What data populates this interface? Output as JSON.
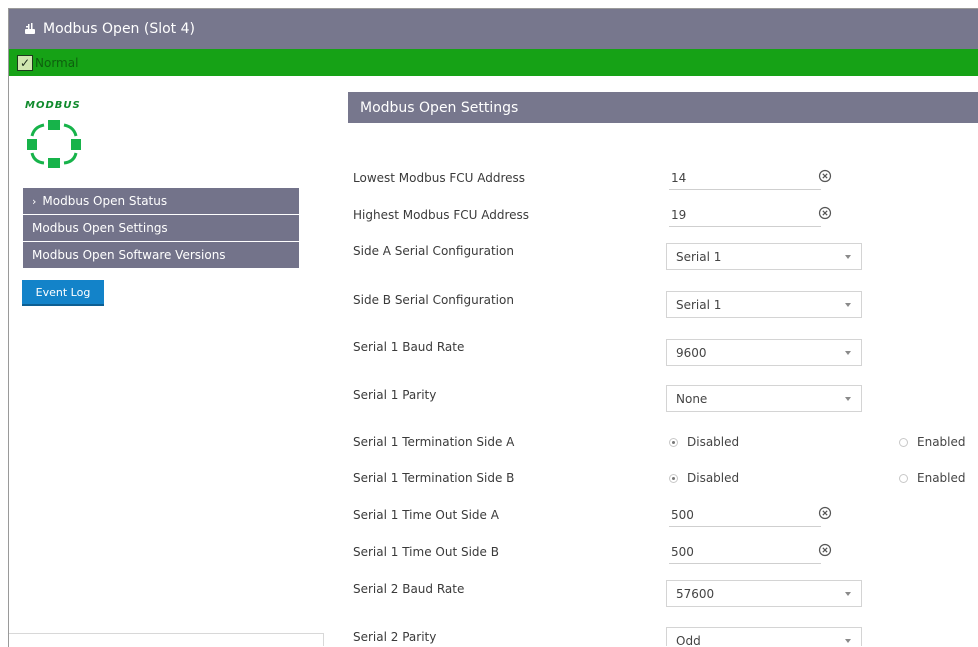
{
  "window": {
    "title": "Modbus Open (Slot 4)",
    "title_icon": "plug-icon"
  },
  "status": {
    "text": "Normal",
    "checked": true,
    "color": "#16a216"
  },
  "sidebar": {
    "logo_text": "MODBUS",
    "items": [
      {
        "label": "Modbus Open Status",
        "chevron": "›"
      },
      {
        "label": "Modbus Open Settings"
      },
      {
        "label": "Modbus Open Software Versions"
      }
    ],
    "event_log_label": "Event Log"
  },
  "main": {
    "section_title": "Modbus Open Settings",
    "fields": {
      "lowest_fcu": {
        "label": "Lowest Modbus FCU Address",
        "value": "14"
      },
      "highest_fcu": {
        "label": "Highest Modbus FCU Address",
        "value": "19"
      },
      "side_a_serial": {
        "label": "Side A Serial Configuration",
        "value": "Serial 1"
      },
      "side_b_serial": {
        "label": "Side B Serial Configuration",
        "value": "Serial 1"
      },
      "serial1_baud": {
        "label": "Serial 1 Baud Rate",
        "value": "9600"
      },
      "serial1_parity": {
        "label": "Serial 1 Parity",
        "value": "None"
      },
      "serial1_term_a": {
        "label": "Serial 1 Termination Side A",
        "option_disabled": "Disabled",
        "option_enabled": "Enabled",
        "selected": "Disabled"
      },
      "serial1_term_b": {
        "label": "Serial 1 Termination Side B",
        "option_disabled": "Disabled",
        "option_enabled": "Enabled",
        "selected": "Disabled"
      },
      "serial1_timeout_a": {
        "label": "Serial 1 Time Out Side A",
        "value": "500"
      },
      "serial1_timeout_b": {
        "label": "Serial 1 Time Out Side B",
        "value": "500"
      },
      "serial2_baud": {
        "label": "Serial 2 Baud Rate",
        "value": "57600"
      },
      "serial2_parity": {
        "label": "Serial 2 Parity",
        "value": "Odd"
      }
    }
  },
  "colors": {
    "header": "#77778d",
    "status_green": "#16a216",
    "event_log_blue": "#1383c9",
    "logo_green": "#0f8a2c"
  }
}
